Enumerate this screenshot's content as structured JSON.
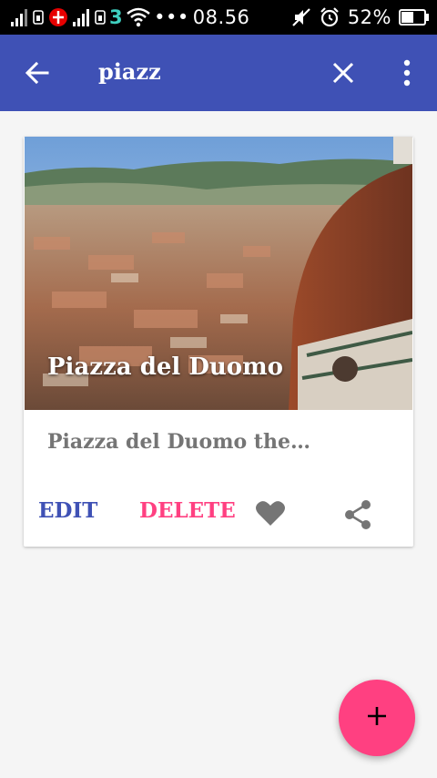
{
  "status_bar": {
    "time": "08.56",
    "ellipsis": "•••",
    "carrier_digit": "3",
    "battery": "52%"
  },
  "app_bar": {
    "search_query": "piazz",
    "icons": [
      "arrow-back-icon",
      "close-icon",
      "more-vert-icon"
    ],
    "color": "#3f51b5"
  },
  "card": {
    "image_caption": "Piazza del Duomo",
    "description": "Piazza del Duomo the…",
    "actions": {
      "edit_label": "EDIT",
      "delete_label": "DELETE"
    },
    "colors": {
      "edit": "#3f51b5",
      "delete": "#ff4081",
      "icon": "#757575"
    }
  },
  "fab": {
    "icon": "add-icon",
    "color": "#ff4081"
  }
}
